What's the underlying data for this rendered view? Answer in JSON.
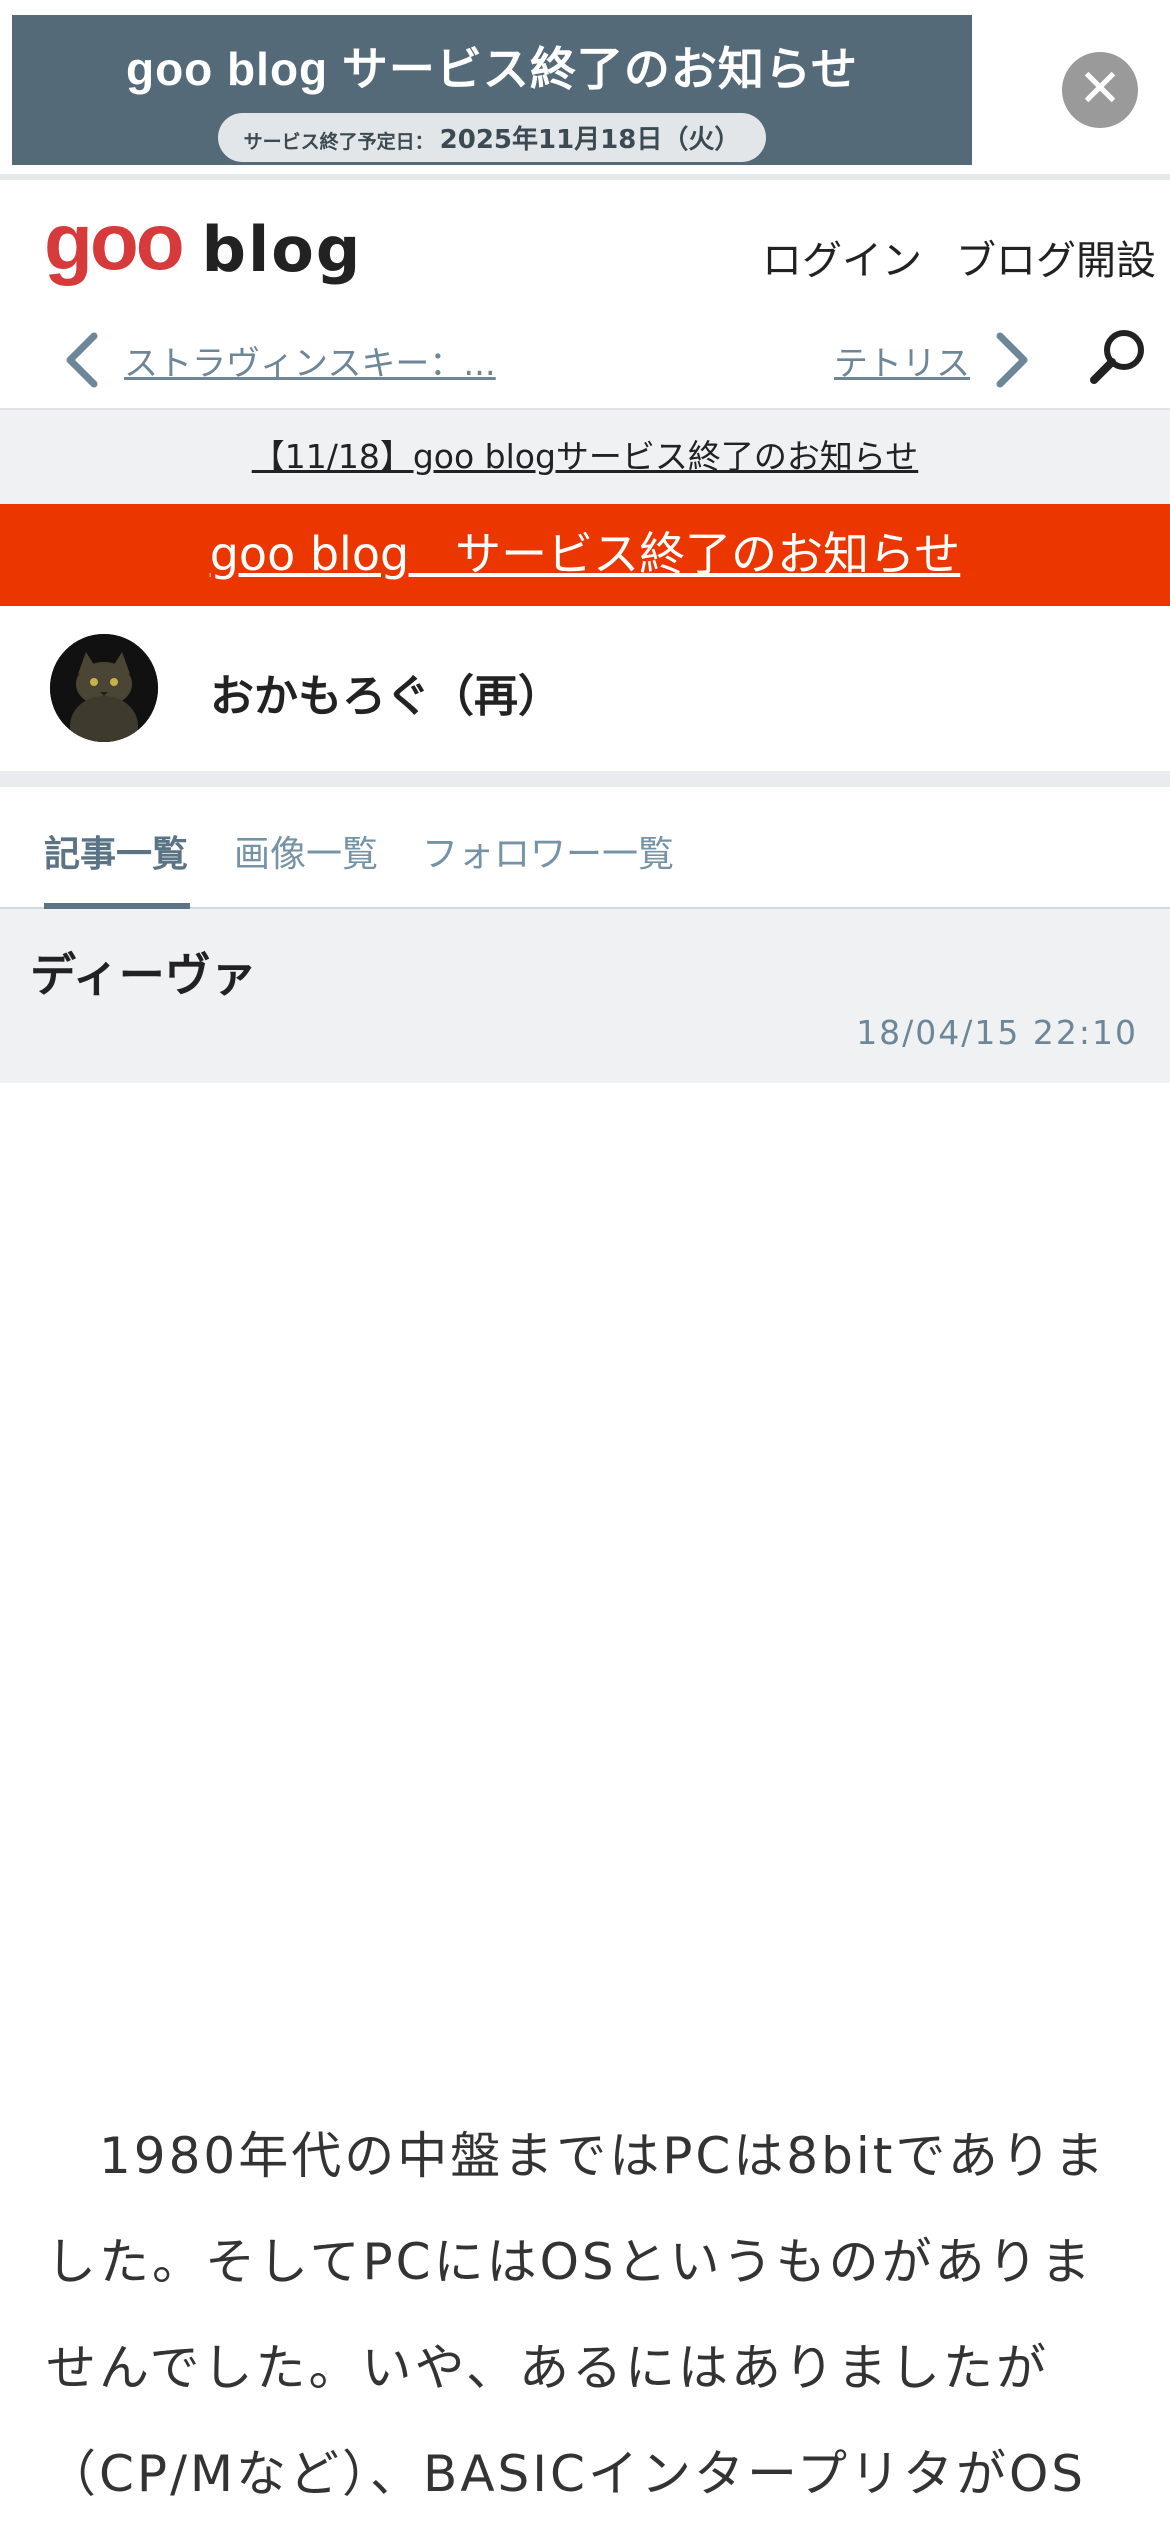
{
  "ad": {
    "title": "goo blog サービス終了のお知らせ",
    "pill_label": "サービス終了予定日：",
    "pill_date": "2025年11月18日（火）",
    "close_glyph": "✕"
  },
  "header": {
    "logo_goo": "goo",
    "logo_blog": "blog",
    "login": "ログイン",
    "open_blog": "ブログ開設"
  },
  "nav": {
    "prev_label": "ストラヴィンスキー：...",
    "next_label": "テトリス"
  },
  "notice": {
    "strip_text": "【11/18】goo blogサービス終了のお知らせ",
    "red_bar_text": "goo blog　サービス終了のお知らせ"
  },
  "profile": {
    "blog_name": "おかもろぐ（再）"
  },
  "tabs": {
    "articles": "記事一覧",
    "images": "画像一覧",
    "followers": "フォロワー一覧"
  },
  "article": {
    "title": "ディーヴァ",
    "date": "18/04/15 22:10",
    "body": "　1980年代の中盤まではPCは8bitでありました。そしてPCにはOSというものがありませんでした。いや、あるにはありましたが（CP/Mなど）、BASICインタープリタがOS代"
  },
  "colors": {
    "ad_bg": "#546a78",
    "red_bar": "#ec3600",
    "logo_red": "#d63a3a",
    "link_gray": "#6d8799"
  }
}
